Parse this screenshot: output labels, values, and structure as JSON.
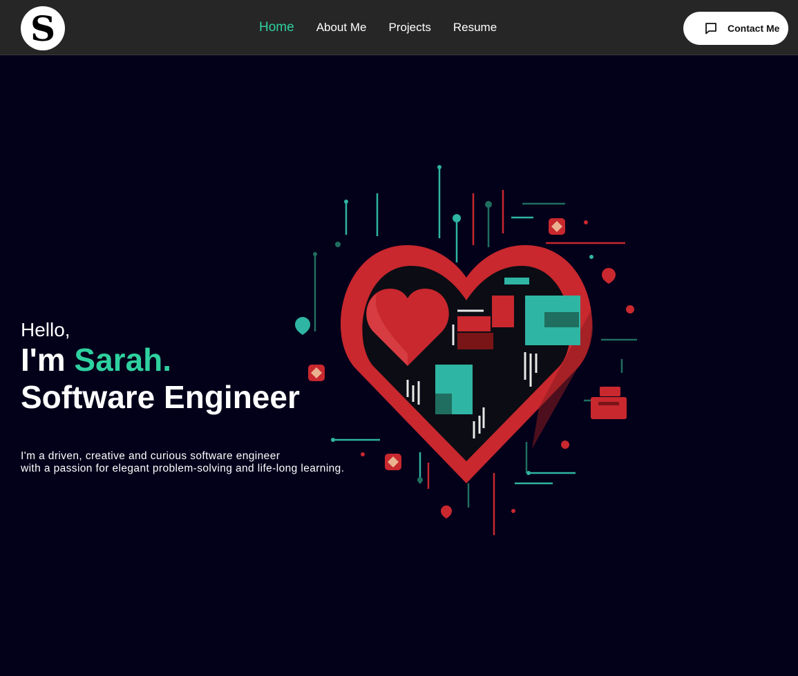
{
  "header": {
    "logo_letter": "S",
    "nav": [
      {
        "label": "Home",
        "active": true
      },
      {
        "label": "About Me",
        "active": false
      },
      {
        "label": "Projects",
        "active": false
      },
      {
        "label": "Resume",
        "active": false
      }
    ],
    "contact_button": {
      "label": "Contact Me",
      "icon": "message-square-icon"
    }
  },
  "hero": {
    "greeting": "Hello,",
    "intro_prefix": "I'm ",
    "name": "Sarah.",
    "role": "Software Engineer",
    "bio_line1": "I'm a driven, creative and curious software engineer",
    "bio_line2": "with a passion for elegant problem-solving and life-long learning.",
    "image_icon": "circuit-heart-illustration"
  },
  "colors": {
    "background": "#03001a",
    "navbar": "#262626",
    "accent": "#2ed19f",
    "heart_red": "#c8282e",
    "teal": "#2fb5a3"
  }
}
